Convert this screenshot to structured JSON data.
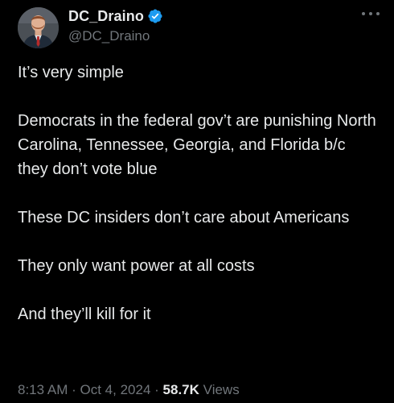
{
  "author": {
    "display_name": "DC_Draino",
    "handle": "@DC_Draino",
    "verified": true,
    "verified_color": "#1d9bf0"
  },
  "tweet": {
    "paragraphs": [
      "It’s very simple",
      "Democrats in the federal gov’t are punishing North Carolina, Tennessee, Georgia, and Florida b/c they don’t vote blue",
      "These DC insiders don’t care about Americans",
      "They only want power at all costs",
      "And they’ll kill for it"
    ]
  },
  "meta": {
    "time": "8:13 AM",
    "separator": "·",
    "date": "Oct 4, 2024",
    "views_count": "58.7K",
    "views_label": "Views"
  },
  "icons": {
    "more": "more-horizontal-icon",
    "verified": "verified-badge-icon"
  }
}
